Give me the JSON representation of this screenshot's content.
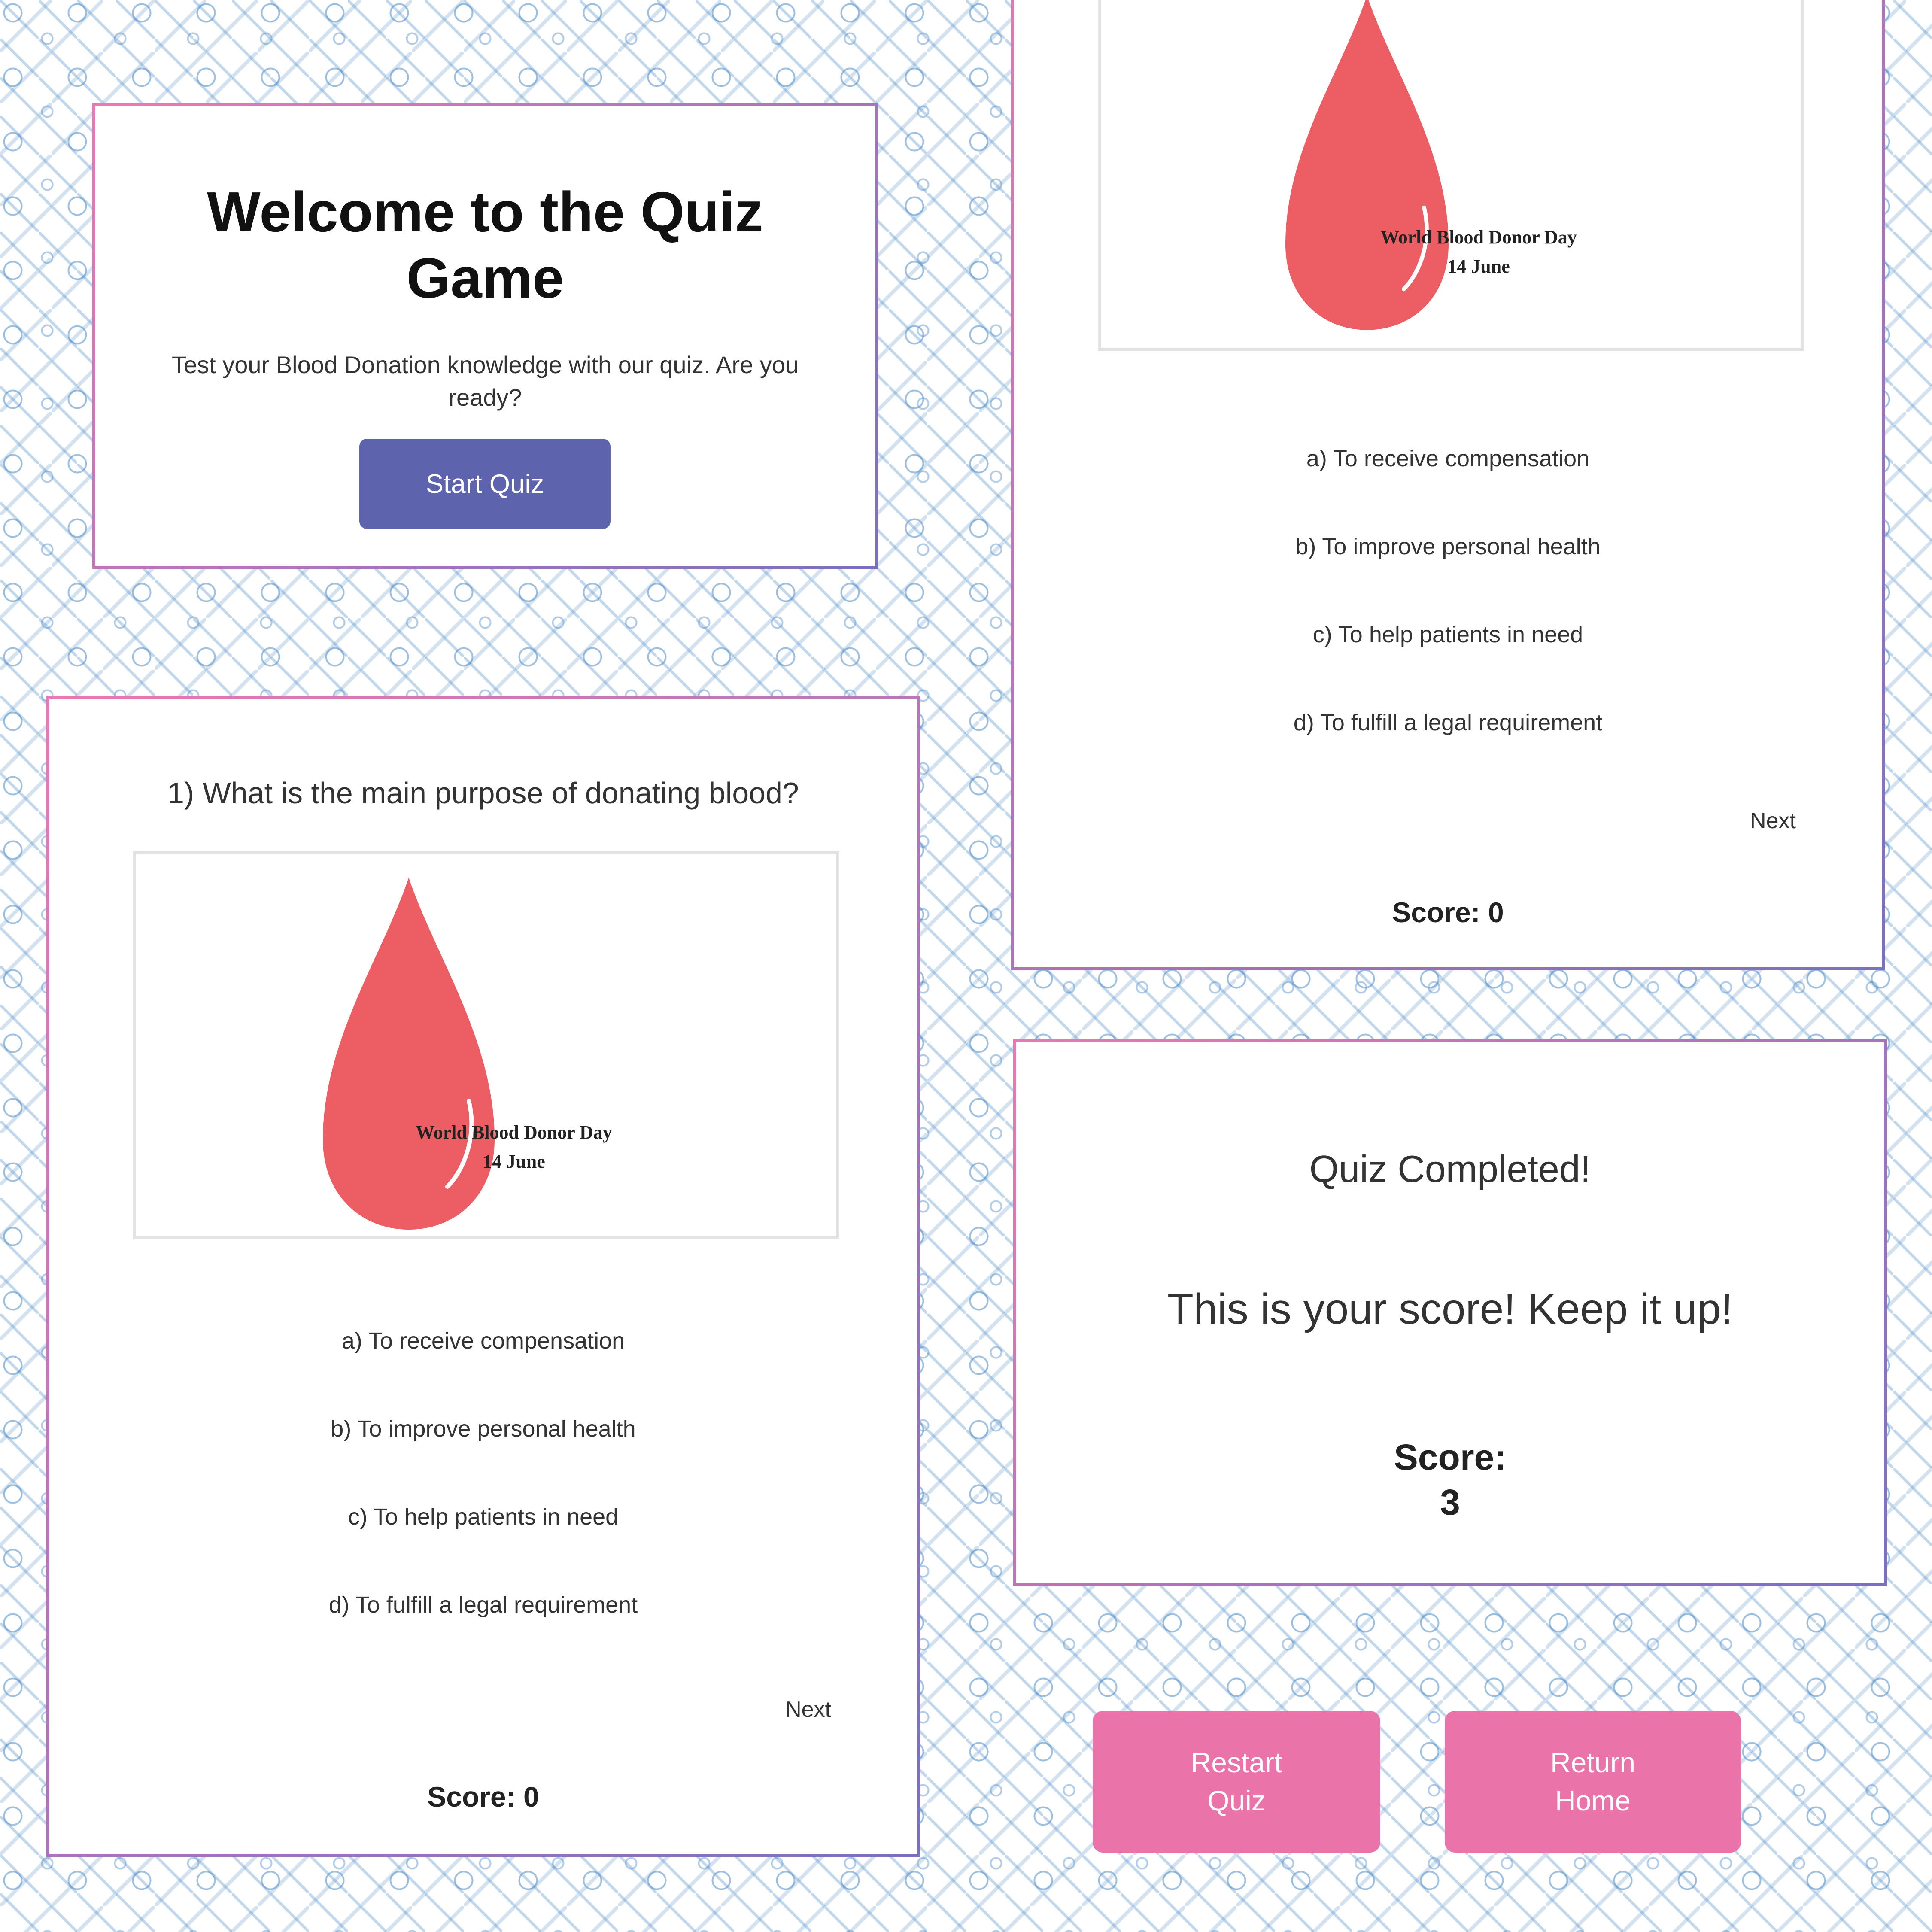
{
  "welcome": {
    "title": "Welcome to the Quiz Game",
    "subtitle": "Test your Blood Donation knowledge with our quiz. Are you ready?",
    "start_button": "Start Quiz"
  },
  "quiz": {
    "question": "1) What is the main purpose of donating blood?",
    "image_caption_line1": "World Blood Donor Day",
    "image_caption_line2": "14 June",
    "options": [
      "a) To receive compensation",
      "b) To improve personal health",
      "c) To help patients in need",
      "d) To fulfill a legal requirement"
    ],
    "next_label": "Next",
    "score_label": "Score: 0"
  },
  "results": {
    "title": "Quiz Completed!",
    "message": "This is your score! Keep it up!",
    "score_label": "Score:",
    "score_value": "3",
    "restart_button": "Restart Quiz",
    "home_button": "Return Home"
  },
  "colors": {
    "accent_purple": "#5e63ae",
    "accent_pink": "#ea73a9",
    "blood_red": "#ec5e63",
    "pattern_blue": "#4f8dc7"
  }
}
